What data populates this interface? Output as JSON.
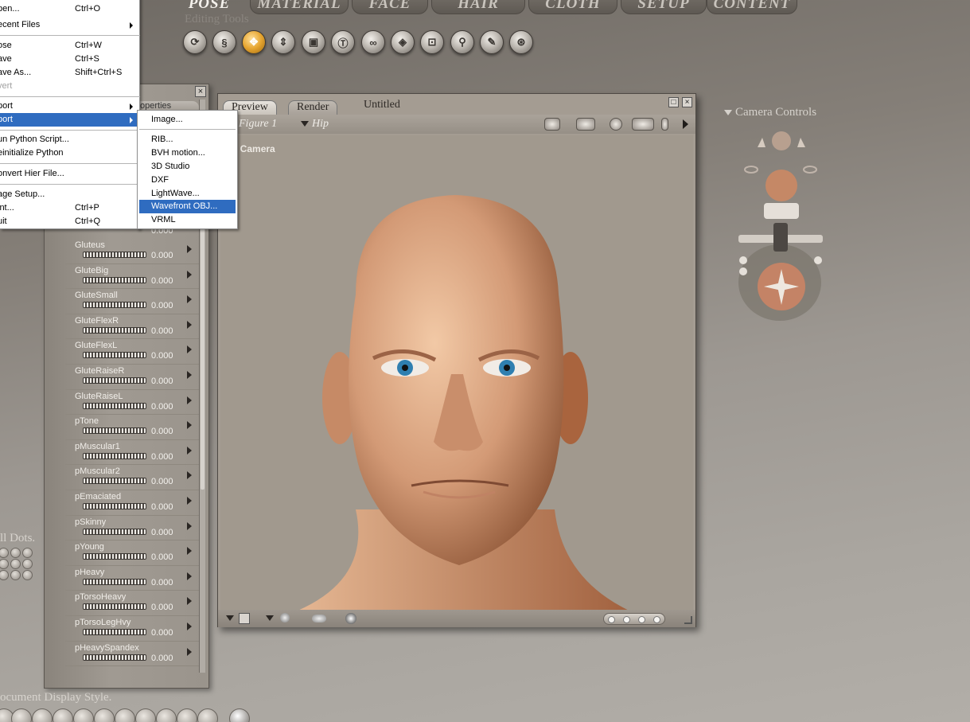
{
  "top_tabs": [
    {
      "label": "POSE",
      "active": true
    },
    {
      "label": "MATERIAL",
      "active": false
    },
    {
      "label": "FACE",
      "active": false
    },
    {
      "label": "HAIR",
      "active": false
    },
    {
      "label": "CLOTH",
      "active": false
    },
    {
      "label": "SETUP",
      "active": false
    },
    {
      "label": "CONTENT",
      "active": false
    }
  ],
  "editing_tools": {
    "label": "Editing Tools",
    "tools": [
      {
        "icon": "rotate-icon"
      },
      {
        "icon": "twist-icon"
      },
      {
        "icon": "translate-icon",
        "active": true
      },
      {
        "icon": "translate-in-out-icon"
      },
      {
        "icon": "scale-icon"
      },
      {
        "icon": "taper-icon"
      },
      {
        "icon": "chain-break-icon"
      },
      {
        "icon": "color-icon"
      },
      {
        "icon": "grouping-icon"
      },
      {
        "icon": "view-magnifier-icon"
      },
      {
        "icon": "morphing-icon"
      },
      {
        "icon": "direct-manipulation-icon"
      }
    ]
  },
  "file_menu": {
    "items": [
      {
        "label": "pen...",
        "shortcut": "Ctrl+O"
      },
      {
        "label": "ecent Files",
        "submenu": true
      },
      {
        "separator": true
      },
      {
        "label": "ose",
        "shortcut": "Ctrl+W"
      },
      {
        "label": "ave",
        "shortcut": "Ctrl+S"
      },
      {
        "label": "ave As...",
        "shortcut": "Shift+Ctrl+S"
      },
      {
        "label": "vert",
        "disabled": true
      },
      {
        "separator": true
      },
      {
        "label": "port",
        "submenu": true
      },
      {
        "label": "port",
        "submenu": true,
        "highlighted": true
      },
      {
        "separator": true
      },
      {
        "label": "un Python Script..."
      },
      {
        "label": "einitialize Python"
      },
      {
        "separator": true
      },
      {
        "label": "onvert Hier File..."
      },
      {
        "separator": true
      },
      {
        "label": "age Setup..."
      },
      {
        "label": "int...",
        "shortcut": "Ctrl+P"
      },
      {
        "label": "uit",
        "shortcut": "Ctrl+Q"
      }
    ]
  },
  "export_submenu": {
    "items": [
      {
        "label": "Image..."
      },
      {
        "separator": true
      },
      {
        "label": "RIB..."
      },
      {
        "label": "BVH motion..."
      },
      {
        "label": "3D Studio"
      },
      {
        "label": "DXF"
      },
      {
        "label": "LightWave..."
      },
      {
        "label": "Wavefront OBJ...",
        "highlighted": true
      },
      {
        "label": "VRML"
      }
    ]
  },
  "parameters_panel": {
    "tab_label": "operties",
    "close_glyph": "×",
    "first_value": "0.000",
    "dials": [
      {
        "name": "Gluteus",
        "value": "0.000"
      },
      {
        "name": "GluteBig",
        "value": "0.000"
      },
      {
        "name": "GluteSmall",
        "value": "0.000"
      },
      {
        "name": "GluteFlexR",
        "value": "0.000"
      },
      {
        "name": "GluteFlexL",
        "value": "0.000"
      },
      {
        "name": "GluteRaiseR",
        "value": "0.000"
      },
      {
        "name": "GluteRaiseL",
        "value": "0.000"
      },
      {
        "name": "pTone",
        "value": "0.000"
      },
      {
        "name": "pMuscular1",
        "value": "0.000"
      },
      {
        "name": "pMuscular2",
        "value": "0.000"
      },
      {
        "name": "pEmaciated",
        "value": "0.000"
      },
      {
        "name": "pSkinny",
        "value": "0.000"
      },
      {
        "name": "pYoung",
        "value": "0.000"
      },
      {
        "name": "pHeavy",
        "value": "0.000"
      },
      {
        "name": "pTorsoHeavy",
        "value": "0.000"
      },
      {
        "name": "pTorsoLegHvy",
        "value": "0.000"
      },
      {
        "name": "pHeavySpandex",
        "value": "0.000"
      }
    ]
  },
  "preview_window": {
    "tabs": [
      {
        "label": "Preview",
        "active": true
      },
      {
        "label": "Render",
        "active": false
      }
    ],
    "document_title": "Untitled",
    "figure_selector": "Figure 1",
    "element_selector": "Hip",
    "camera_label": "ce Camera",
    "maximize_glyph": "□",
    "close_glyph": "×"
  },
  "camera_controls": {
    "label": "Camera Controls"
  },
  "left_side": {
    "ball_dots_label": "ll Dots.",
    "document_display_label": "ocument Display Style."
  },
  "colors": {
    "menu_highlight": "#2f6cc0",
    "active_tool": "#e6a530",
    "skin": "#d9a27c"
  }
}
